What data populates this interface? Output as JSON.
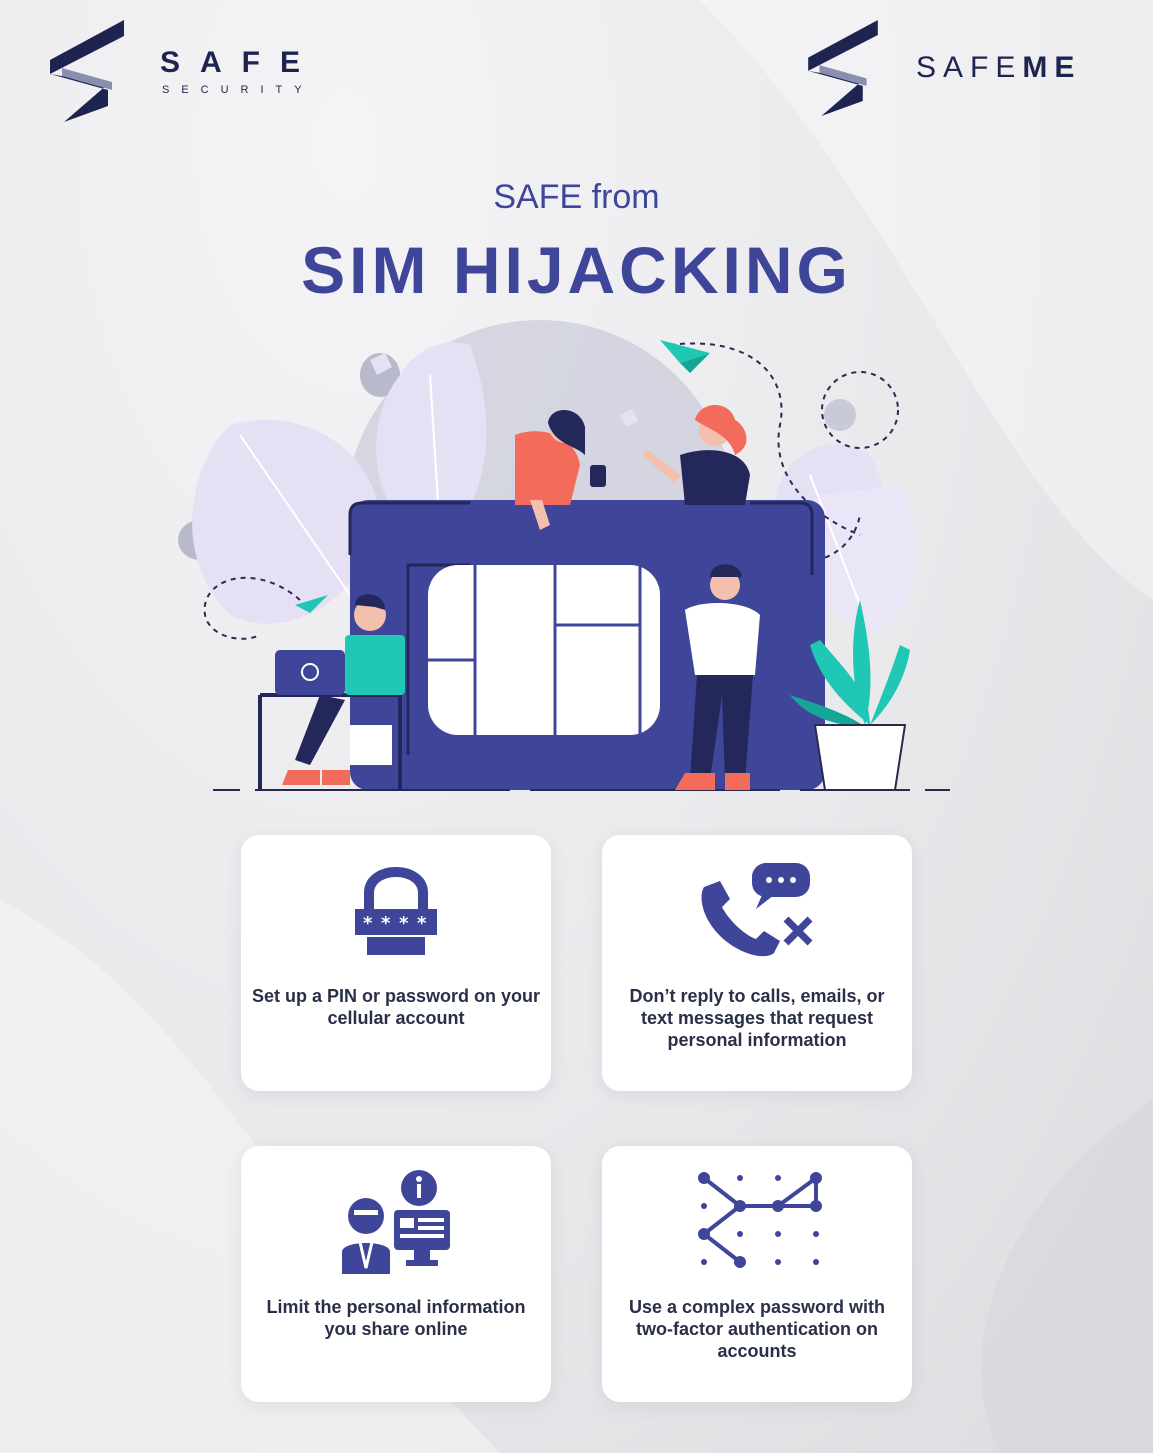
{
  "logos": {
    "left": {
      "name": "SAFE",
      "tagline": "SECURITY"
    },
    "right": {
      "name_light": "SAFE",
      "name_bold": "ME"
    }
  },
  "header": {
    "subtitle": "SAFE from",
    "title": "SIM HIJACKING"
  },
  "tips": [
    {
      "icon": "padlock-password-icon",
      "text": "Set up a PIN or password on your cellular account"
    },
    {
      "icon": "decline-call-message-icon",
      "text": "Don’t reply to calls, emails, or text messages that request personal information"
    },
    {
      "icon": "person-info-screen-icon",
      "text": "Limit the personal information you share online"
    },
    {
      "icon": "pattern-lock-icon",
      "text": "Use a complex password with two-factor authentication on accounts"
    }
  ],
  "colors": {
    "brand_navy": "#1e2450",
    "accent_indigo": "#3f4699",
    "teal": "#1fc7b4",
    "coral": "#f26b5b",
    "lavender": "#e6e0f5"
  }
}
